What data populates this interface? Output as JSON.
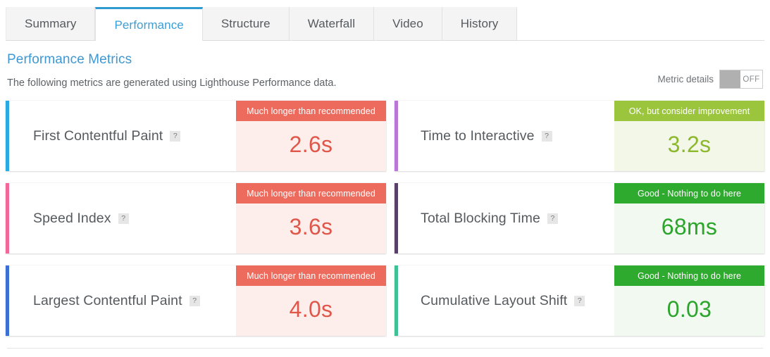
{
  "tabs": [
    {
      "label": "Summary",
      "active": false
    },
    {
      "label": "Performance",
      "active": true
    },
    {
      "label": "Structure",
      "active": false
    },
    {
      "label": "Waterfall",
      "active": false
    },
    {
      "label": "Video",
      "active": false
    },
    {
      "label": "History",
      "active": false
    }
  ],
  "header": {
    "title": "Performance Metrics",
    "subtitle": "The following metrics are generated using Lighthouse Performance data."
  },
  "metric_details_toggle": {
    "label": "Metric details",
    "state": "OFF",
    "on": false
  },
  "help_badge_glyph": "?",
  "status_labels": {
    "bad": "Much longer than recommended",
    "ok": "OK, but consider improvement",
    "good": "Good - Nothing to do here"
  },
  "colors": {
    "active_tab": "#2f9ad0",
    "title": "#3d98d4",
    "bad_banner": "#ec6b5d",
    "bad_value": "#e0574a",
    "ok_banner": "#9bc53d",
    "ok_value": "#8db82e",
    "good_banner": "#2eaa2e",
    "good_value": "#2aa52a"
  },
  "metrics": [
    {
      "name": "First Contentful Paint",
      "value": "2.6s",
      "status": "bad",
      "status_label": "Much longer than recommended",
      "accent": "#29abe2",
      "column": "left"
    },
    {
      "name": "Time to Interactive",
      "value": "3.2s",
      "status": "ok",
      "status_label": "OK, but consider improvement",
      "accent": "#b978d8",
      "column": "right"
    },
    {
      "name": "Speed Index",
      "value": "3.6s",
      "status": "bad",
      "status_label": "Much longer than recommended",
      "accent": "#f2689b",
      "column": "left"
    },
    {
      "name": "Total Blocking Time",
      "value": "68ms",
      "status": "good",
      "status_label": "Good - Nothing to do here",
      "accent": "#584068",
      "column": "right"
    },
    {
      "name": "Largest Contentful Paint",
      "value": "4.0s",
      "status": "bad",
      "status_label": "Much longer than recommended",
      "accent": "#3b6fd4",
      "column": "left"
    },
    {
      "name": "Cumulative Layout Shift",
      "value": "0.03",
      "status": "good",
      "status_label": "Good - Nothing to do here",
      "accent": "#3fc195",
      "column": "right"
    }
  ]
}
